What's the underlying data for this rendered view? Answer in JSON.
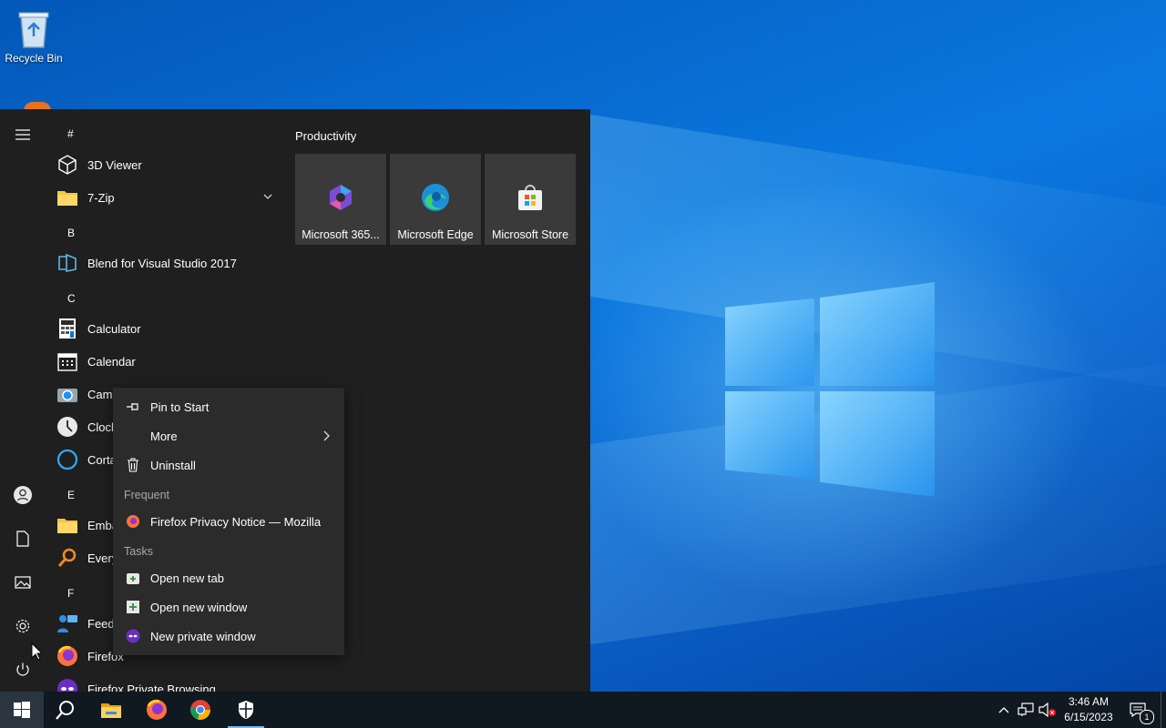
{
  "desktop": {
    "icons": [
      {
        "label": "Recycle Bin",
        "icon": "recycle-bin-icon"
      }
    ]
  },
  "start_menu": {
    "letters": [
      "#",
      "B",
      "C",
      "E",
      "F"
    ],
    "apps": [
      {
        "name": "3D Viewer",
        "icon": "cube-icon"
      },
      {
        "name": "7-Zip",
        "icon": "folder-icon"
      },
      {
        "name": "Blend for Visual Studio 2017",
        "icon": "blend-icon"
      },
      {
        "name": "Calculator",
        "icon": "calculator-icon"
      },
      {
        "name": "Calendar",
        "icon": "calendar-icon"
      },
      {
        "name": "Came",
        "icon": "camera-icon"
      },
      {
        "name": "Clock",
        "icon": "clock-icon"
      },
      {
        "name": "Corta",
        "icon": "cortana-icon"
      },
      {
        "name": "Emba",
        "icon": "folder-icon"
      },
      {
        "name": "Every",
        "icon": "search-icon"
      },
      {
        "name": "Feed",
        "icon": "feedback-icon"
      },
      {
        "name": "Firefox",
        "icon": "firefox-icon"
      },
      {
        "name": "Firefox Private Browsing",
        "icon": "private-browsing-icon"
      }
    ],
    "tiles_group": "Productivity",
    "tiles": [
      {
        "label": "Microsoft 365...",
        "icon": "microsoft-365-icon"
      },
      {
        "label": "Microsoft Edge",
        "icon": "edge-icon"
      },
      {
        "label": "Microsoft Store",
        "icon": "store-icon"
      }
    ]
  },
  "context_menu": {
    "items": [
      {
        "label": "Pin to Start",
        "icon": "pin-icon"
      },
      {
        "label": "More",
        "icon": "chevron-right-icon"
      },
      {
        "label": "Uninstall",
        "icon": "trash-icon"
      }
    ],
    "frequent_header": "Frequent",
    "frequent": [
      {
        "label": "Firefox Privacy Notice — Mozilla",
        "icon": "firefox-icon"
      }
    ],
    "tasks_header": "Tasks",
    "tasks": [
      {
        "label": "Open new tab",
        "icon": "new-tab-icon"
      },
      {
        "label": "Open new window",
        "icon": "new-window-icon"
      },
      {
        "label": "New private window",
        "icon": "private-browsing-icon"
      }
    ]
  },
  "taskbar": {
    "time": "3:46 AM",
    "date": "6/15/2023",
    "notification_count": "1"
  }
}
